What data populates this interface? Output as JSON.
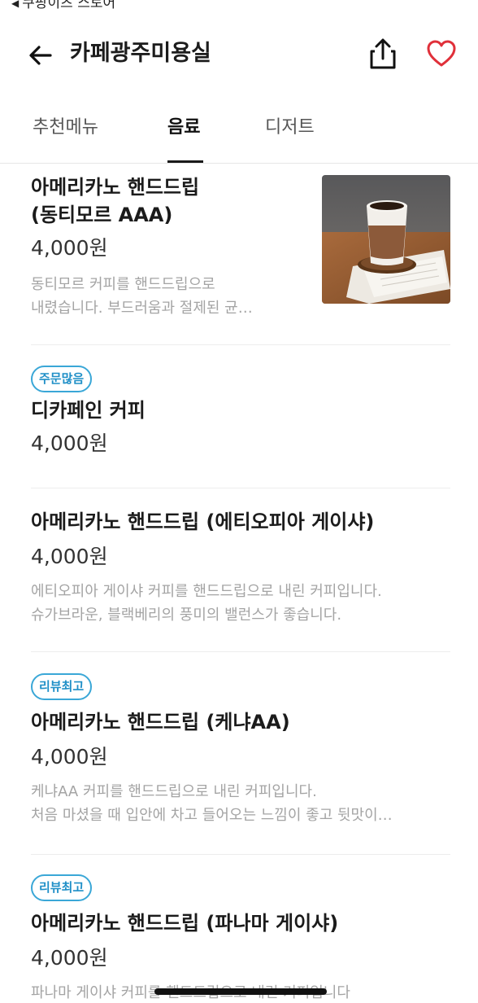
{
  "status": {
    "back_app": "쿠팡이츠 스토어"
  },
  "header": {
    "store_name": "카페광주미용실"
  },
  "tabs": [
    {
      "label": "추천메뉴",
      "active": false
    },
    {
      "label": "음료",
      "active": true
    },
    {
      "label": "디저트",
      "active": false
    }
  ],
  "items": [
    {
      "name_line1": "아메리카노 핸드드립",
      "name_line2": "(동티모르 AAA)",
      "price": "4,000원",
      "desc_line1": "동티모르 커피를 핸드드립으로",
      "desc_line2": "내렸습니다. 부드러움과 절제된 균…",
      "has_image": true
    },
    {
      "badge": "주문많음",
      "name": "디카페인 커피",
      "price": "4,000원"
    },
    {
      "name": "아메리카노 핸드드립 (에티오피아 게이샤)",
      "price": "4,000원",
      "desc_line1": "에티오피아 게이샤 커피를 핸드드립으로 내린 커피입니다.",
      "desc_line2": "슈가브라운, 블랙베리의 풍미의 밸런스가 좋습니다."
    },
    {
      "badge": "리뷰최고",
      "name": "아메리카노 핸드드립 (케냐AA)",
      "price": "4,000원",
      "desc_line1": "케냐AA 커피를 핸드드립으로 내린 커피입니다.",
      "desc_line2": "처음 마셨을 때 입안에 차고 들어오는 느낌이 좋고 뒷맛이…"
    },
    {
      "badge": "리뷰최고",
      "name": "아메리카노 핸드드립 (파나마 게이샤)",
      "price": "4,000원",
      "desc_line1": "파나마 게이샤 커피를 핸드드립으로 내린 커피입니다"
    }
  ],
  "colors": {
    "accent_red": "#e0303a",
    "badge_blue": "#1f8fc7"
  },
  "icons": [
    "back-arrow-icon",
    "share-icon",
    "heart-icon"
  ]
}
